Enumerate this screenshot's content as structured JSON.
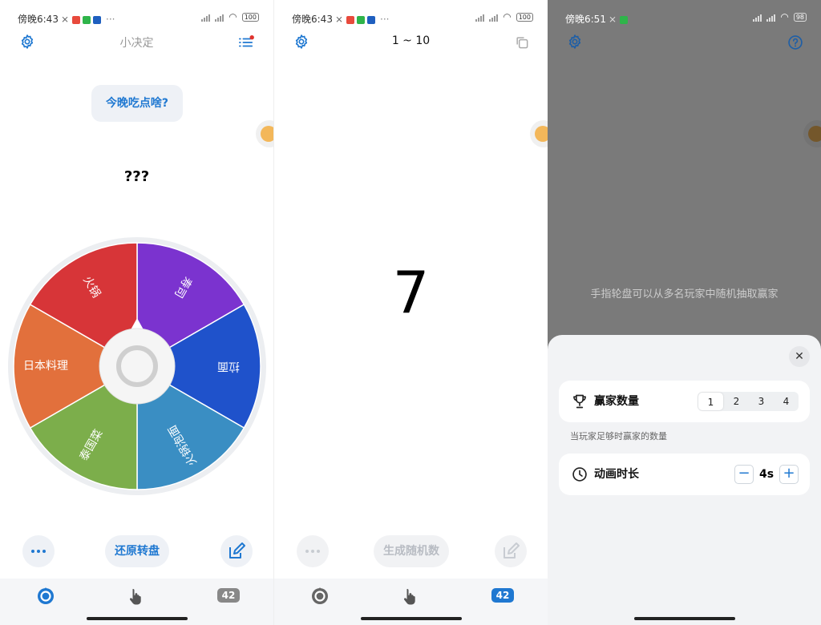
{
  "colors": {
    "accent": "#1f78d1",
    "badge_active": "#1f78d1",
    "badge_inactive": "#888888"
  },
  "panel1": {
    "status_time": "傍晚6:43",
    "battery": "100",
    "title": "小决定",
    "prompt": "今晚吃点啥?",
    "result": "???",
    "wheel": {
      "segments": [
        {
          "label": "寿司",
          "color": "#7b33cf"
        },
        {
          "label": "拉面",
          "color": "#1f52cb"
        },
        {
          "label": "火锅泡面",
          "color": "#3a8ec3"
        },
        {
          "label": "泰国菜",
          "color": "#7cae4b"
        },
        {
          "label": "日本料理",
          "color": "#e2703c"
        },
        {
          "label": "火锅",
          "color": "#d73538"
        }
      ]
    },
    "restore_label": "还原转盘",
    "nav_badge": "42"
  },
  "panel2": {
    "status_time": "傍晚6:43",
    "battery": "100",
    "title": "1 ~ 10",
    "number": "7",
    "generate_label": "生成随机数",
    "nav_badge": "42"
  },
  "panel3": {
    "status_time": "傍晚6:51",
    "battery": "98",
    "hint": "手指轮盘可以从多名玩家中随机抽取赢家",
    "winners_label": "赢家数量",
    "winner_options": [
      "1",
      "2",
      "3",
      "4"
    ],
    "winners_selected": "1",
    "winners_note": "当玩家足够时赢家的数量",
    "duration_label": "动画时长",
    "duration_value": "4s",
    "minus": "−",
    "plus": "+",
    "close": "✕"
  }
}
